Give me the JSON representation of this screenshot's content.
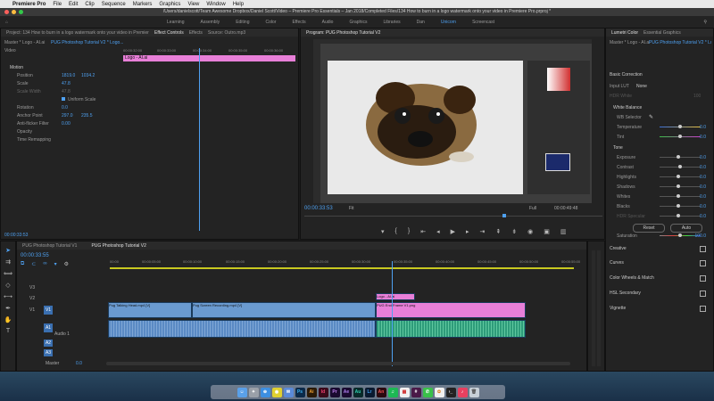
{
  "menubar": {
    "app": "Premiere Pro",
    "items": [
      "File",
      "Edit",
      "Clip",
      "Sequence",
      "Markers",
      "Graphics",
      "View",
      "Window",
      "Help"
    ],
    "status": "Fri 4:29 PM"
  },
  "window_title": "/Users/danielscott/Team Awesome Dropbox/Daniel Scott/Video – Premiere Pro Essentials – Jan 2018/Completed Files/134 How to burn in a logo watermark onto your video in Premiere Pro.prproj *",
  "workspaces": [
    "Learning",
    "Assembly",
    "Editing",
    "Color",
    "Effects",
    "Audio",
    "Graphics",
    "Libraries",
    "Dan",
    "Unicorn",
    "Screencast"
  ],
  "active_workspace": "Unicorn",
  "effect_controls": {
    "tabs": [
      "Project: 134 How to burn in a logo watermark onto your video in Premiere Pro",
      "Effect Controls",
      "Effects",
      "Source: Outro.mp3"
    ],
    "master": "Master * Logo - AI.ai",
    "sequence": "PUG Photoshop Tutorial V2 * Logo...",
    "section": "Video",
    "ruler": [
      "00:00:32:00",
      "00:00:33:00",
      "00:00:34:00",
      "00:00:35:00",
      "00:00:36:00"
    ],
    "clip_label": "Logo - AI.ai",
    "motion": "Motion",
    "props": [
      {
        "name": "Position",
        "v1": "1819.0",
        "v2": "1034.2"
      },
      {
        "name": "Scale",
        "v1": "47.8",
        "v2": ""
      },
      {
        "name": "Scale Width",
        "v1": "47.8",
        "v2": ""
      },
      {
        "name": "Uniform Scale",
        "v1": "",
        "v2": ""
      },
      {
        "name": "Rotation",
        "v1": "0.0",
        "v2": ""
      },
      {
        "name": "Anchor Point",
        "v1": "297.0",
        "v2": "235.5"
      },
      {
        "name": "Anti-flicker Filter",
        "v1": "0.00",
        "v2": ""
      }
    ],
    "opacity": "Opacity",
    "time_remap": "Time Remapping",
    "timecode": "00:00:33:53"
  },
  "program": {
    "title": "Program: PUG Photoshop Tutorial V2",
    "timecode": "00:00:33:53",
    "fit": "Fit",
    "quality": "Full",
    "duration": "00:00:49:48"
  },
  "lumetri": {
    "tabs": [
      "Lumetri Color",
      "Essential Graphics"
    ],
    "master": "Master * Logo - AI.ai",
    "sequence": "PUG Photoshop Tutorial V2 * Logo...",
    "basic": "Basic Correction",
    "input_lut": "Input LUT",
    "input_lut_val": "None",
    "hdr_white": "HDR White",
    "hdr_val": "100",
    "wb": "White Balance",
    "wb_selector": "WB Selector",
    "temperature": "Temperature",
    "tint": "Tint",
    "tone": "Tone",
    "controls": [
      {
        "name": "Temperature",
        "val": "0.0",
        "pos": 0.5
      },
      {
        "name": "Tint",
        "val": "0.0",
        "pos": 0.5
      }
    ],
    "tone_controls": [
      {
        "name": "Exposure",
        "val": "0.0",
        "pos": 0.45
      },
      {
        "name": "Contrast",
        "val": "0.0",
        "pos": 0.5
      },
      {
        "name": "Highlights",
        "val": "0.0",
        "pos": 0.45
      },
      {
        "name": "Shadows",
        "val": "0.0",
        "pos": 0.45
      },
      {
        "name": "Whites",
        "val": "0.0",
        "pos": 0.45
      },
      {
        "name": "Blacks",
        "val": "0.0",
        "pos": 0.45
      },
      {
        "name": "HDR Specular",
        "val": "0.0",
        "pos": 0.45
      }
    ],
    "reset": "Reset",
    "auto": "Auto",
    "saturation": "Saturation",
    "saturation_val": "100.0",
    "sections": [
      "Creative",
      "Curves",
      "Color Wheels & Match",
      "HSL Secondary",
      "Vignette"
    ]
  },
  "timeline": {
    "tabs": [
      "PUG Photoshop Tutorial V1",
      "PUG Photoshop Tutorial V2"
    ],
    "timecode": "00:00:33:55",
    "ruler": [
      "00:00",
      "00:00:05:00",
      "00:00:10:00",
      "00:00:15:00",
      "00:00:20:00",
      "00:00:25:00",
      "00:00:30:00",
      "00:00:35:00",
      "00:00:40:00",
      "00:00:45:00",
      "00:00:50:00",
      "00:00:55:00"
    ],
    "tracks": [
      "V3",
      "V2",
      "V1",
      "A1",
      "A2",
      "A3",
      "Master"
    ],
    "audio_label": "Audio 1",
    "master_val": "0.0",
    "clips": {
      "logo": "Logo - AI.ai",
      "v1a": "Pug Talking Head.mp4 [V]",
      "v1b": "Pug Screen Recording.mp4 [V]",
      "v1c": "PUG End Frame V1.png"
    }
  },
  "dock_icons": [
    "Finder",
    "Launchpad",
    "Safari",
    "Chrome",
    "Mail",
    "Ps",
    "Ai",
    "Id",
    "Pr",
    "Ae",
    "Au",
    "Sl",
    "An",
    "Spotify",
    "Calendar",
    "Slack",
    "Messages",
    "Photos",
    "Terminal",
    "Music",
    "Trash"
  ],
  "colors": {
    "accent": "#4ea0f0",
    "pink": "#e87fd8",
    "video_clip": "#6a9ad0",
    "audio_clip": "#2e9c7a"
  }
}
